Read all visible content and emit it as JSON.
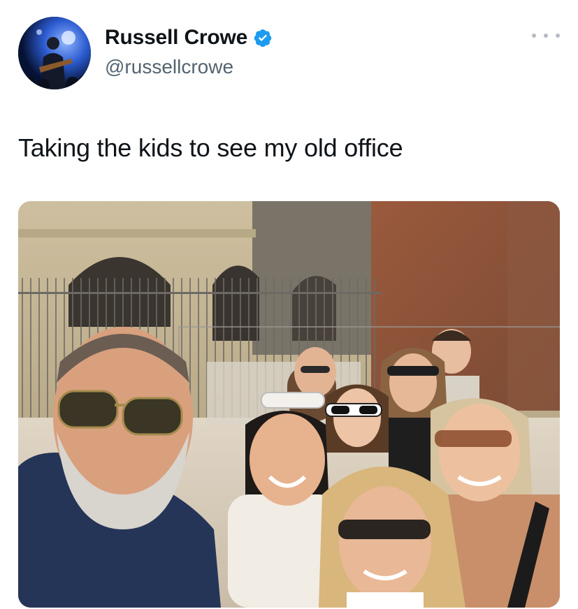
{
  "author": {
    "display_name": "Russell Crowe",
    "handle": "@russellcrowe",
    "verified": true,
    "verified_icon": "verified-badge-icon",
    "verified_color": "#1d9bf0"
  },
  "tweet": {
    "text": "Taking the kids to see my old office",
    "more_icon": "more-options-icon"
  },
  "media": {
    "type": "photo",
    "photo_icon": "group-selfie-photo"
  },
  "colors": {
    "text": "#0f1419",
    "secondary": "#536471",
    "background": "#ffffff"
  }
}
